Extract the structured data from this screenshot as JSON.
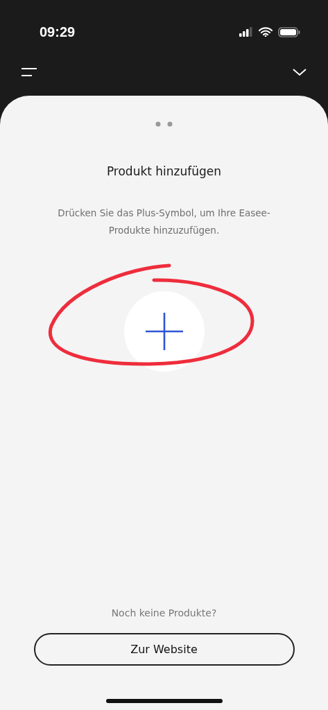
{
  "status_bar": {
    "time": "09:29"
  },
  "sheet": {
    "title": "Produkt hinzufügen",
    "description": "Drücken Sie das Plus-Symbol, um Ihre Easee-Produkte hinzuzufügen.",
    "hint": "Noch keine Produkte?",
    "button": "Zur Website"
  }
}
